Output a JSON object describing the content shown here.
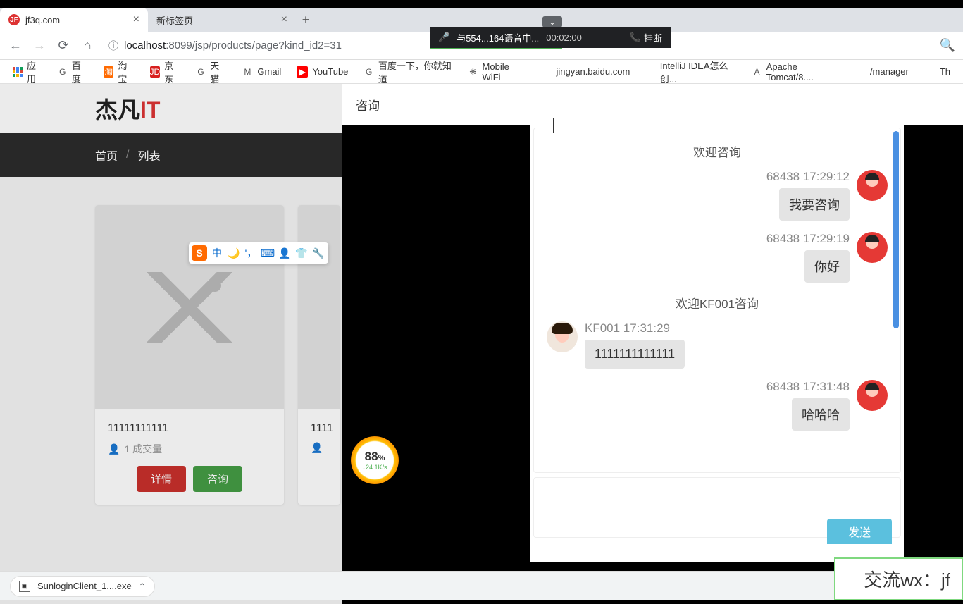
{
  "topDark": "",
  "tabs": [
    {
      "title": "jf3q.com",
      "active": true
    },
    {
      "title": "新标签页",
      "active": false
    }
  ],
  "url": {
    "host": "localhost",
    "port": ":8099",
    "path": "/jsp/products/page?kind_id2=31"
  },
  "bookmarks": [
    {
      "label": "应用",
      "icon": "apps"
    },
    {
      "label": "百度",
      "iconText": "G",
      "iconBg": "#fff"
    },
    {
      "label": "淘宝",
      "iconText": "淘",
      "iconBg": "#ff6a00"
    },
    {
      "label": "京东",
      "iconText": "JD",
      "iconBg": "#d8201f"
    },
    {
      "label": "天猫",
      "iconText": "G",
      "iconBg": "#fff"
    },
    {
      "label": "Gmail",
      "iconText": "M",
      "iconBg": "#fff"
    },
    {
      "label": "YouTube",
      "iconText": "▶",
      "iconBg": "#f00"
    },
    {
      "label": "百度一下，你就知道",
      "iconText": "G",
      "iconBg": "#fff"
    },
    {
      "label": "Mobile WiFi",
      "iconText": "❋",
      "iconBg": "#fff"
    },
    {
      "label": "jingyan.baidu.com",
      "iconText": "",
      "iconBg": "#fff"
    },
    {
      "label": "IntelliJ IDEA怎么创...",
      "iconText": "",
      "iconBg": "#fff"
    },
    {
      "label": "Apache Tomcat/8....",
      "iconText": "A",
      "iconBg": "#fff"
    },
    {
      "label": "/manager",
      "iconText": "",
      "iconBg": "#fff"
    },
    {
      "label": "Th",
      "iconText": "",
      "iconBg": "#fff"
    }
  ],
  "call": {
    "text": "与554...164语音中...",
    "time": "00:02:00",
    "hangup": "挂断"
  },
  "site": {
    "logoMain": "杰凡",
    "logoAccent": "IT",
    "breadcrumb": {
      "home": "首页",
      "list": "列表"
    },
    "products": [
      {
        "title": "11111111111",
        "meta": "1 成交量",
        "detail": "详情",
        "consult": "咨询"
      },
      {
        "title": "1111",
        "meta": "",
        "detail": "",
        "consult": ""
      }
    ]
  },
  "ime": {
    "logo": "S",
    "mode": "中"
  },
  "speed": {
    "pct": "88",
    "pctUnit": "%",
    "rate": "↓24.1K/s"
  },
  "chat": {
    "headerTitle": "咨询",
    "sendLabel": "发送",
    "messages": [
      {
        "type": "system",
        "text": "欢迎咨询"
      },
      {
        "type": "right",
        "name": "68438",
        "time": "17:29:12",
        "text": "我要咨询"
      },
      {
        "type": "right",
        "name": "68438",
        "time": "17:29:19",
        "text": "你好"
      },
      {
        "type": "system",
        "text": "欢迎KF001咨询"
      },
      {
        "type": "left",
        "name": "KF001",
        "time": "17:31:29",
        "text": "1111111111111"
      },
      {
        "type": "right",
        "name": "68438",
        "time": "17:31:48",
        "text": "哈哈哈"
      }
    ]
  },
  "download": {
    "file": "SunloginClient_1....exe"
  },
  "watermark": "交流wx：jf"
}
